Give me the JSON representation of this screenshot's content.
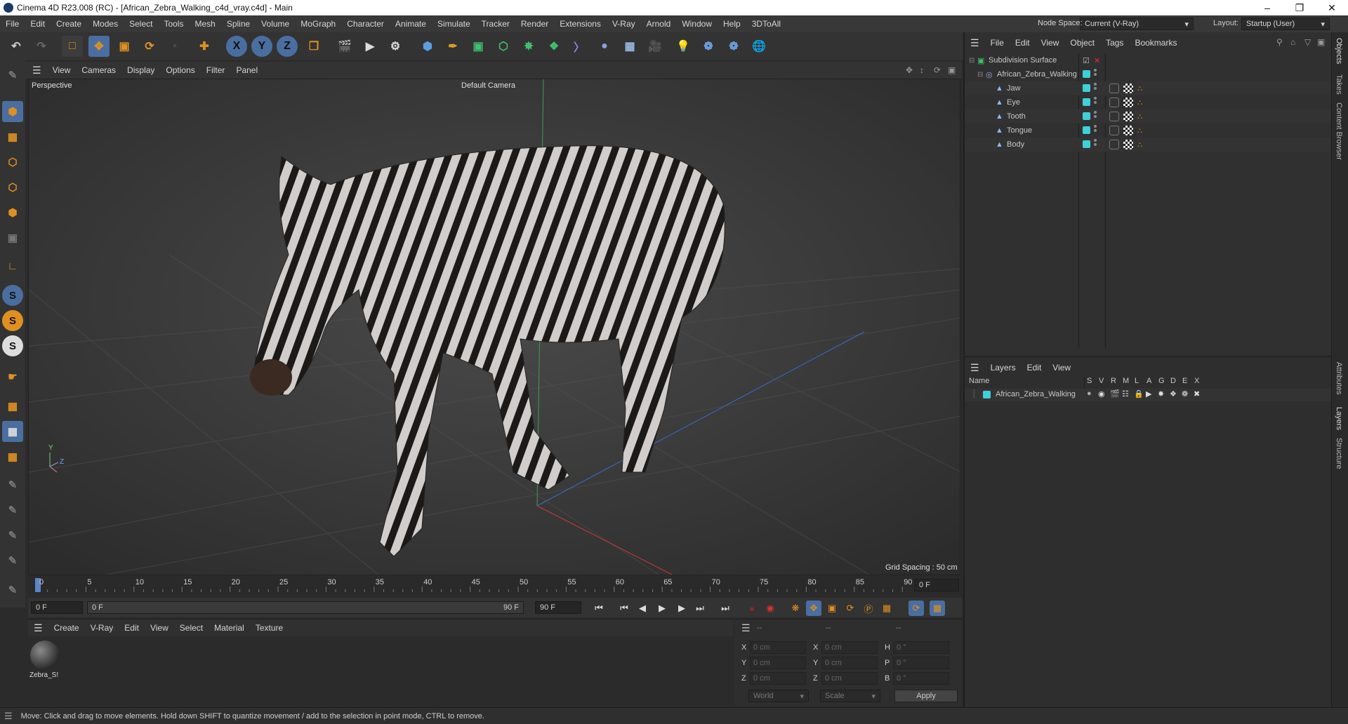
{
  "window": {
    "title": "Cinema 4D R23.008 (RC) - [African_Zebra_Walking_c4d_vray.c4d] - Main"
  },
  "menubar": {
    "items": [
      "File",
      "Edit",
      "Create",
      "Modes",
      "Select",
      "Tools",
      "Mesh",
      "Spline",
      "Volume",
      "MoGraph",
      "Character",
      "Animate",
      "Simulate",
      "Tracker",
      "Render",
      "Extensions",
      "V-Ray",
      "Arnold",
      "Window",
      "Help",
      "3DToAll"
    ],
    "node_space_label": "Node Space:",
    "node_space_value": "Current (V-Ray)",
    "layout_label": "Layout:",
    "layout_value": "Startup (User)"
  },
  "toolbar": {
    "axis": [
      "X",
      "Y",
      "Z"
    ]
  },
  "viewport": {
    "menu": [
      "View",
      "Cameras",
      "Display",
      "Options",
      "Filter",
      "Panel"
    ],
    "view_name": "Perspective",
    "camera": "Default Camera",
    "grid_spacing": "Grid Spacing : 50 cm",
    "axis_labels": [
      "Y",
      "Z"
    ]
  },
  "timeline": {
    "ticks": [
      "0",
      "5",
      "10",
      "15",
      "20",
      "25",
      "30",
      "35",
      "40",
      "45",
      "50",
      "55",
      "60",
      "65",
      "70",
      "75",
      "80",
      "85",
      "90"
    ],
    "current_frame": "0 F"
  },
  "transport": {
    "start_field": "0 F",
    "range_start": "0 F",
    "range_end": "90 F",
    "end_field": "90 F"
  },
  "material_panel": {
    "menu": [
      "Create",
      "V-Ray",
      "Edit",
      "View",
      "Select",
      "Material",
      "Texture"
    ],
    "materials": [
      {
        "name": "Zebra_S!"
      }
    ]
  },
  "coord_panel": {
    "headers": [
      "--",
      "--",
      "--"
    ],
    "rows": [
      {
        "l1": "X",
        "v1": "0 cm",
        "l2": "X",
        "v2": "0 cm",
        "l3": "H",
        "v3": "0 °"
      },
      {
        "l1": "Y",
        "v1": "0 cm",
        "l2": "Y",
        "v2": "0 cm",
        "l3": "P",
        "v3": "0 °"
      },
      {
        "l1": "Z",
        "v1": "0 cm",
        "l2": "Z",
        "v2": "0 cm",
        "l3": "B",
        "v3": "0 °"
      }
    ],
    "world": "World",
    "scale": "Scale",
    "apply": "Apply"
  },
  "status": {
    "text": "Move: Click and drag to move elements. Hold down SHIFT to quantize movement / add to the selection in point mode, CTRL to remove."
  },
  "objects_panel": {
    "menu": [
      "File",
      "Edit",
      "View",
      "Object",
      "Tags",
      "Bookmarks"
    ],
    "tree": [
      {
        "name": "Subdivision Surface",
        "level": 0
      },
      {
        "name": "African_Zebra_Walking",
        "level": 1
      },
      {
        "name": "Jaw",
        "level": 2
      },
      {
        "name": "Eye",
        "level": 2
      },
      {
        "name": "Tooth",
        "level": 2
      },
      {
        "name": "Tongue",
        "level": 2
      },
      {
        "name": "Body",
        "level": 2
      }
    ]
  },
  "layers_panel": {
    "menu": [
      "Layers",
      "Edit",
      "View"
    ],
    "name_header": "Name",
    "columns": [
      "S",
      "V",
      "R",
      "M",
      "L",
      "A",
      "G",
      "D",
      "E",
      "X"
    ],
    "layers": [
      {
        "name": "African_Zebra_Walking"
      }
    ]
  },
  "right_tabs": [
    "Objects",
    "Takes",
    "Content Browser",
    "Attributes",
    "Layers",
    "Structure"
  ],
  "colors": {
    "accent": "#3fd0d8",
    "selected": "#4a6ea0",
    "orange": "#e09020"
  }
}
